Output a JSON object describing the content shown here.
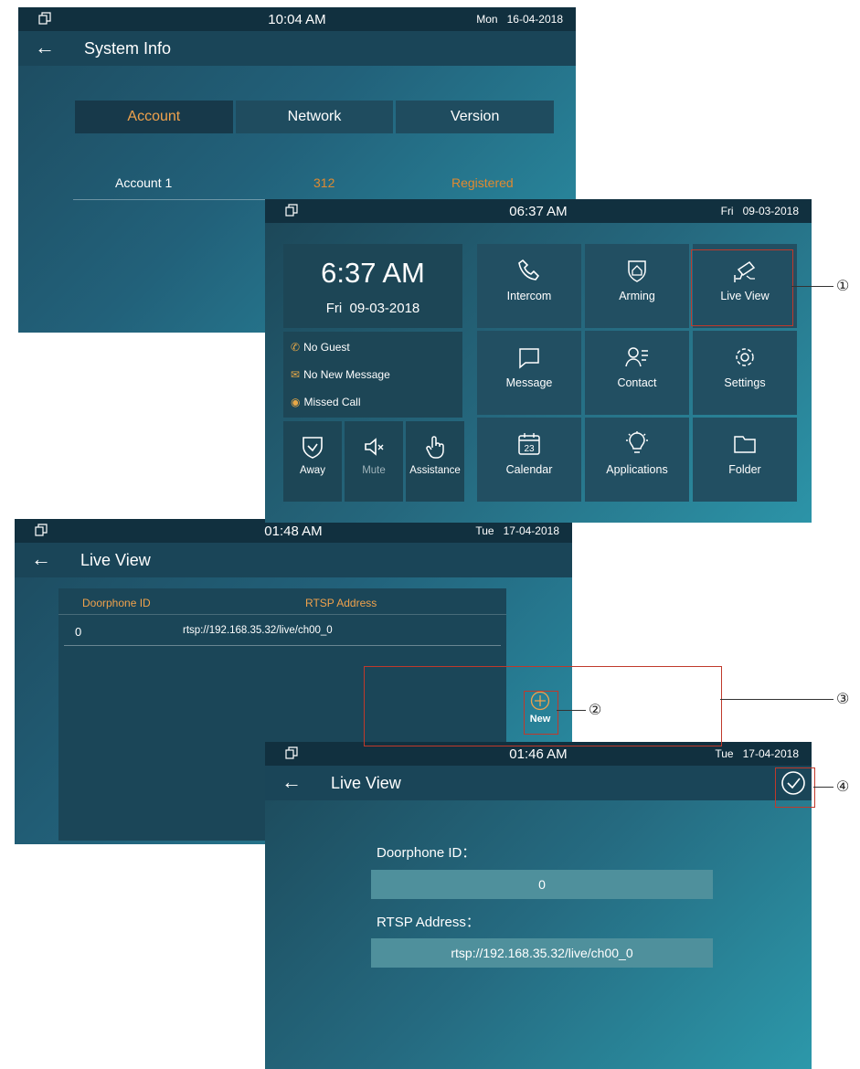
{
  "screen_system_info": {
    "time": "10:04 AM",
    "date": "Mon   16-04-2018",
    "title": "System Info",
    "tabs": [
      "Account",
      "Network",
      "Version"
    ],
    "row": {
      "account": "Account 1",
      "number": "312",
      "status": "Registered"
    }
  },
  "screen_home": {
    "time": "06:37 AM",
    "date": "Fri   09-03-2018",
    "clock_time": "6:37 AM",
    "clock_date": "Fri  09-03-2018",
    "notifications": [
      "No Guest",
      "No New Message",
      "Missed Call"
    ],
    "quick_buttons": [
      "Away",
      "Mute",
      "Assistance"
    ],
    "tiles": [
      "Intercom",
      "Arming",
      "Live View",
      "Message",
      "Contact",
      "Settings",
      "Calendar",
      "Applications",
      "Folder"
    ],
    "calendar_day": "23"
  },
  "screen_live_view_list": {
    "time": "01:48 AM",
    "date": "Tue   17-04-2018",
    "title": "Live View",
    "columns": [
      "Doorphone ID",
      "RTSP Address"
    ],
    "rows": [
      {
        "id": "0",
        "rtsp": "rtsp://192.168.35.32/live/ch00_0"
      }
    ],
    "new_label": "New"
  },
  "screen_live_view_edit": {
    "time": "01:46 AM",
    "date": "Tue   17-04-2018",
    "title": "Live View",
    "doorphone_label": "Doorphone ID：",
    "doorphone_value": "0",
    "rtsp_label": "RTSP Address：",
    "rtsp_value": "rtsp://192.168.35.32/live/ch00_0"
  },
  "annotations": [
    "①",
    "②",
    "③",
    "④"
  ],
  "colors": {
    "accent": "#f0a24c",
    "annotation": "#c0392b",
    "statusbar": "#11303f"
  }
}
